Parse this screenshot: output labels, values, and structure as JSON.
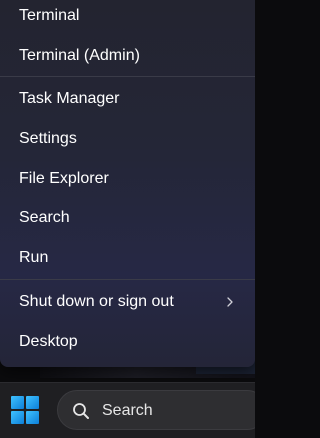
{
  "context_menu": {
    "items": [
      {
        "label": "Terminal"
      },
      {
        "label": "Terminal (Admin)"
      },
      {
        "label": "Task Manager"
      },
      {
        "label": "Settings"
      },
      {
        "label": "File Explorer"
      },
      {
        "label": "Search"
      },
      {
        "label": "Run"
      },
      {
        "label": "Shut down or sign out",
        "icon": "chevron-right-icon"
      },
      {
        "label": "Desktop"
      }
    ]
  },
  "taskbar": {
    "start_icon": "windows-logo-icon",
    "search": {
      "label": "Search",
      "icon": "search-icon"
    }
  },
  "colors": {
    "accent": "#1e9fe8",
    "menu_background": "#242637",
    "taskbar_background": "#1f1f22"
  }
}
